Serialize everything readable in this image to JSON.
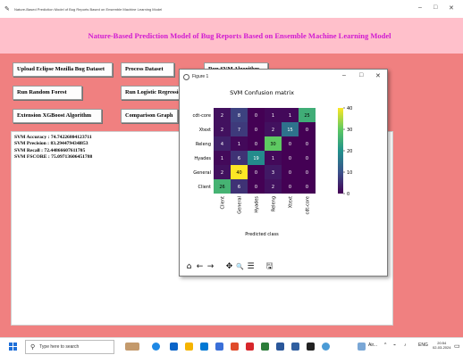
{
  "window": {
    "title": "Nature-Based Prediction Model of Bug Reports Based on Ensemble Machine Learning Model",
    "minimize": "–",
    "maximize": "□",
    "close": "✕"
  },
  "header": {
    "title": "Nature-Based Prediction Model of Bug Reports Based on Ensemble Machine Learning Model"
  },
  "buttons": {
    "upload": "Upload Eclipse Mozilla Bug Dataset",
    "process": "Process Dataset",
    "run_svm": "Run SVM Algorithm",
    "run_rf": "Run Random Forest",
    "run_lr": "Run Logistic Regression",
    "xgboost": "Extension XGBoost Algorithm",
    "graph": "Comparison Graph"
  },
  "output": {
    "lines": [
      "SVM Accuracy : 74.74226804123711",
      "SVM Precision : 83.294479434l853",
      "SVM Recall : 72.44866607611705",
      "SVM FSCORE : 75.09713606451788"
    ]
  },
  "figure": {
    "window_title": "Figure 1",
    "minimize": "–",
    "maximize": "□",
    "close": "✕",
    "toolbar": {
      "home": "⌂",
      "back": "←",
      "forward": "→",
      "pan": "✥",
      "zoom": "🔍",
      "configure": "☰",
      "save": "🖫"
    }
  },
  "chart_data": {
    "type": "heatmap",
    "title": "SVM Confusion matrix",
    "xlabel": "Predicted class",
    "ylabel": "",
    "rows": [
      "cdt-core",
      "Xtext",
      "Releng",
      "Hyades",
      "General",
      "Client"
    ],
    "cols": [
      "Client",
      "General",
      "Hyades",
      "Releng",
      "Xtext",
      "cdt-core"
    ],
    "values": [
      [
        2,
        8,
        0,
        1,
        1,
        25
      ],
      [
        2,
        7,
        0,
        2,
        15,
        0
      ],
      [
        4,
        1,
        0,
        30,
        0,
        0
      ],
      [
        1,
        6,
        19,
        1,
        0,
        0
      ],
      [
        2,
        40,
        0,
        3,
        0,
        0
      ],
      [
        26,
        6,
        0,
        2,
        0,
        0
      ]
    ],
    "colorbar": {
      "min": 0,
      "max": 40,
      "ticks": [
        0,
        10,
        20,
        30,
        40
      ]
    },
    "colormap": "viridis"
  },
  "taskbar": {
    "search_placeholder": "Type here to search",
    "tray_text": "Air...",
    "lang": "ENG",
    "time": "20:54",
    "date": "02-03-2024"
  },
  "colors": {
    "background": "#f08080",
    "header_band": "#ffc0cb",
    "heading_text": "#d11bd1"
  }
}
